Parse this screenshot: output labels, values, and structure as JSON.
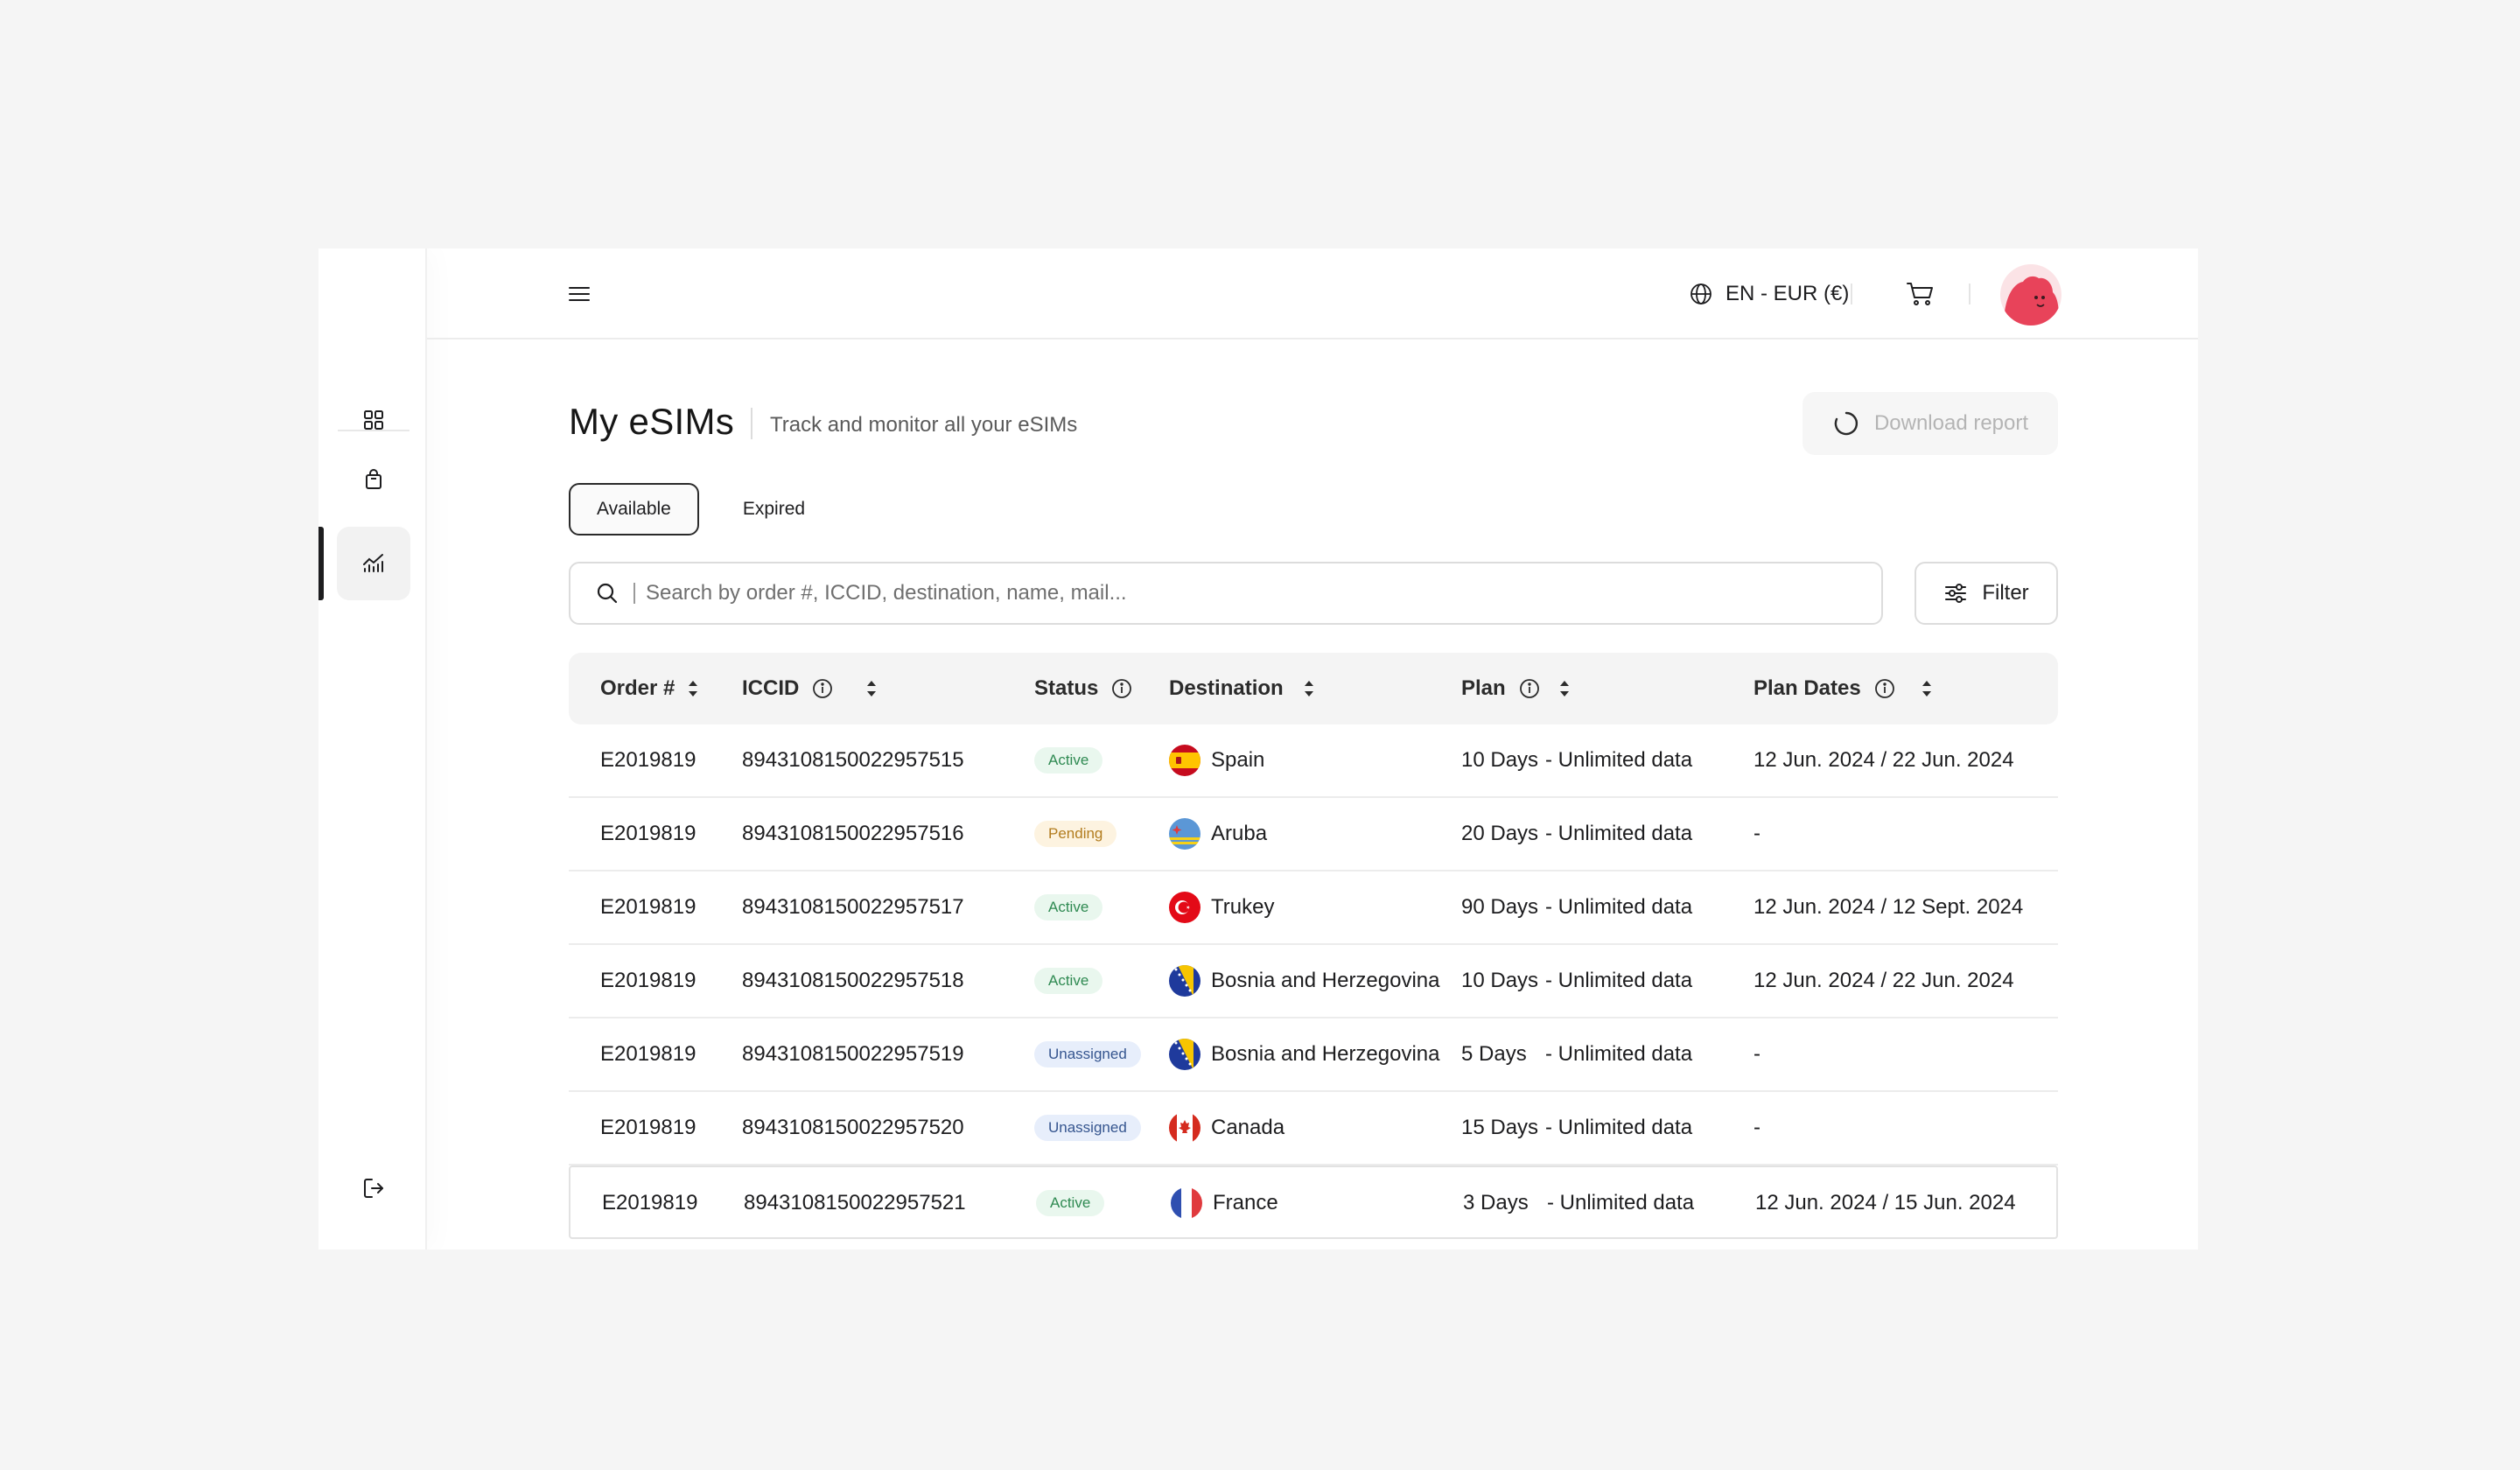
{
  "header": {
    "language_currency": "EN - EUR (€)"
  },
  "page": {
    "title": "My eSIMs",
    "subtitle": "Track and monitor all your eSIMs",
    "download_label": "Download report"
  },
  "tabs": [
    {
      "label": "Available",
      "active": true
    },
    {
      "label": "Expired",
      "active": false
    }
  ],
  "search": {
    "placeholder": "Search by order #, ICCID, destination, name, mail..."
  },
  "filter_label": "Filter",
  "table": {
    "columns": [
      "Order #",
      "ICCID",
      "Status",
      "Destination",
      "Plan",
      "Plan Dates"
    ],
    "rows": [
      {
        "order": "E2019819",
        "iccid": "8943108150022957515",
        "status": "Active",
        "destination": "Spain",
        "plan_days": "10 Days",
        "plan_data": "- Unlimited data",
        "dates": "12 Jun. 2024 / 22 Jun. 2024",
        "flag": "es"
      },
      {
        "order": "E2019819",
        "iccid": "8943108150022957516",
        "status": "Pending",
        "destination": "Aruba",
        "plan_days": "20 Days",
        "plan_data": "- Unlimited data",
        "dates": "-",
        "flag": "aw"
      },
      {
        "order": "E2019819",
        "iccid": "8943108150022957517",
        "status": "Active",
        "destination": "Trukey",
        "plan_days": "90 Days",
        "plan_data": "- Unlimited data",
        "dates": "12 Jun. 2024 / 12 Sept. 2024",
        "flag": "tr"
      },
      {
        "order": "E2019819",
        "iccid": "8943108150022957518",
        "status": "Active",
        "destination": "Bosnia and Herzegovina",
        "plan_days": "10 Days",
        "plan_data": "- Unlimited data",
        "dates": "12 Jun. 2024 / 22 Jun. 2024",
        "flag": "ba"
      },
      {
        "order": "E2019819",
        "iccid": "8943108150022957519",
        "status": "Unassigned",
        "destination": "Bosnia and Herzegovina",
        "plan_days": "5 Days",
        "plan_data": "- Unlimited data",
        "dates": "-",
        "flag": "ba"
      },
      {
        "order": "E2019819",
        "iccid": "8943108150022957520",
        "status": "Unassigned",
        "destination": "Canada",
        "plan_days": "15 Days",
        "plan_data": "- Unlimited data",
        "dates": "-",
        "flag": "ca"
      },
      {
        "order": "E2019819",
        "iccid": "8943108150022957521",
        "status": "Active",
        "destination": "France",
        "plan_days": "3 Days",
        "plan_data": "- Unlimited data",
        "dates": "12 Jun. 2024 / 15 Jun. 2024",
        "flag": "fr"
      }
    ]
  },
  "status_colors": {
    "Active": {
      "bg": "#e9f7ee",
      "fg": "#2f8a52"
    },
    "Pending": {
      "bg": "#fdf3e0",
      "fg": "#b27c1e"
    },
    "Unassigned": {
      "bg": "#e7eefb",
      "fg": "#35558f"
    }
  },
  "icons": {
    "sidebar": [
      "grid-icon",
      "shopping-bag-icon",
      "chart-icon",
      "logout-icon"
    ],
    "header": [
      "menu-icon",
      "globe-icon",
      "cart-icon"
    ]
  }
}
